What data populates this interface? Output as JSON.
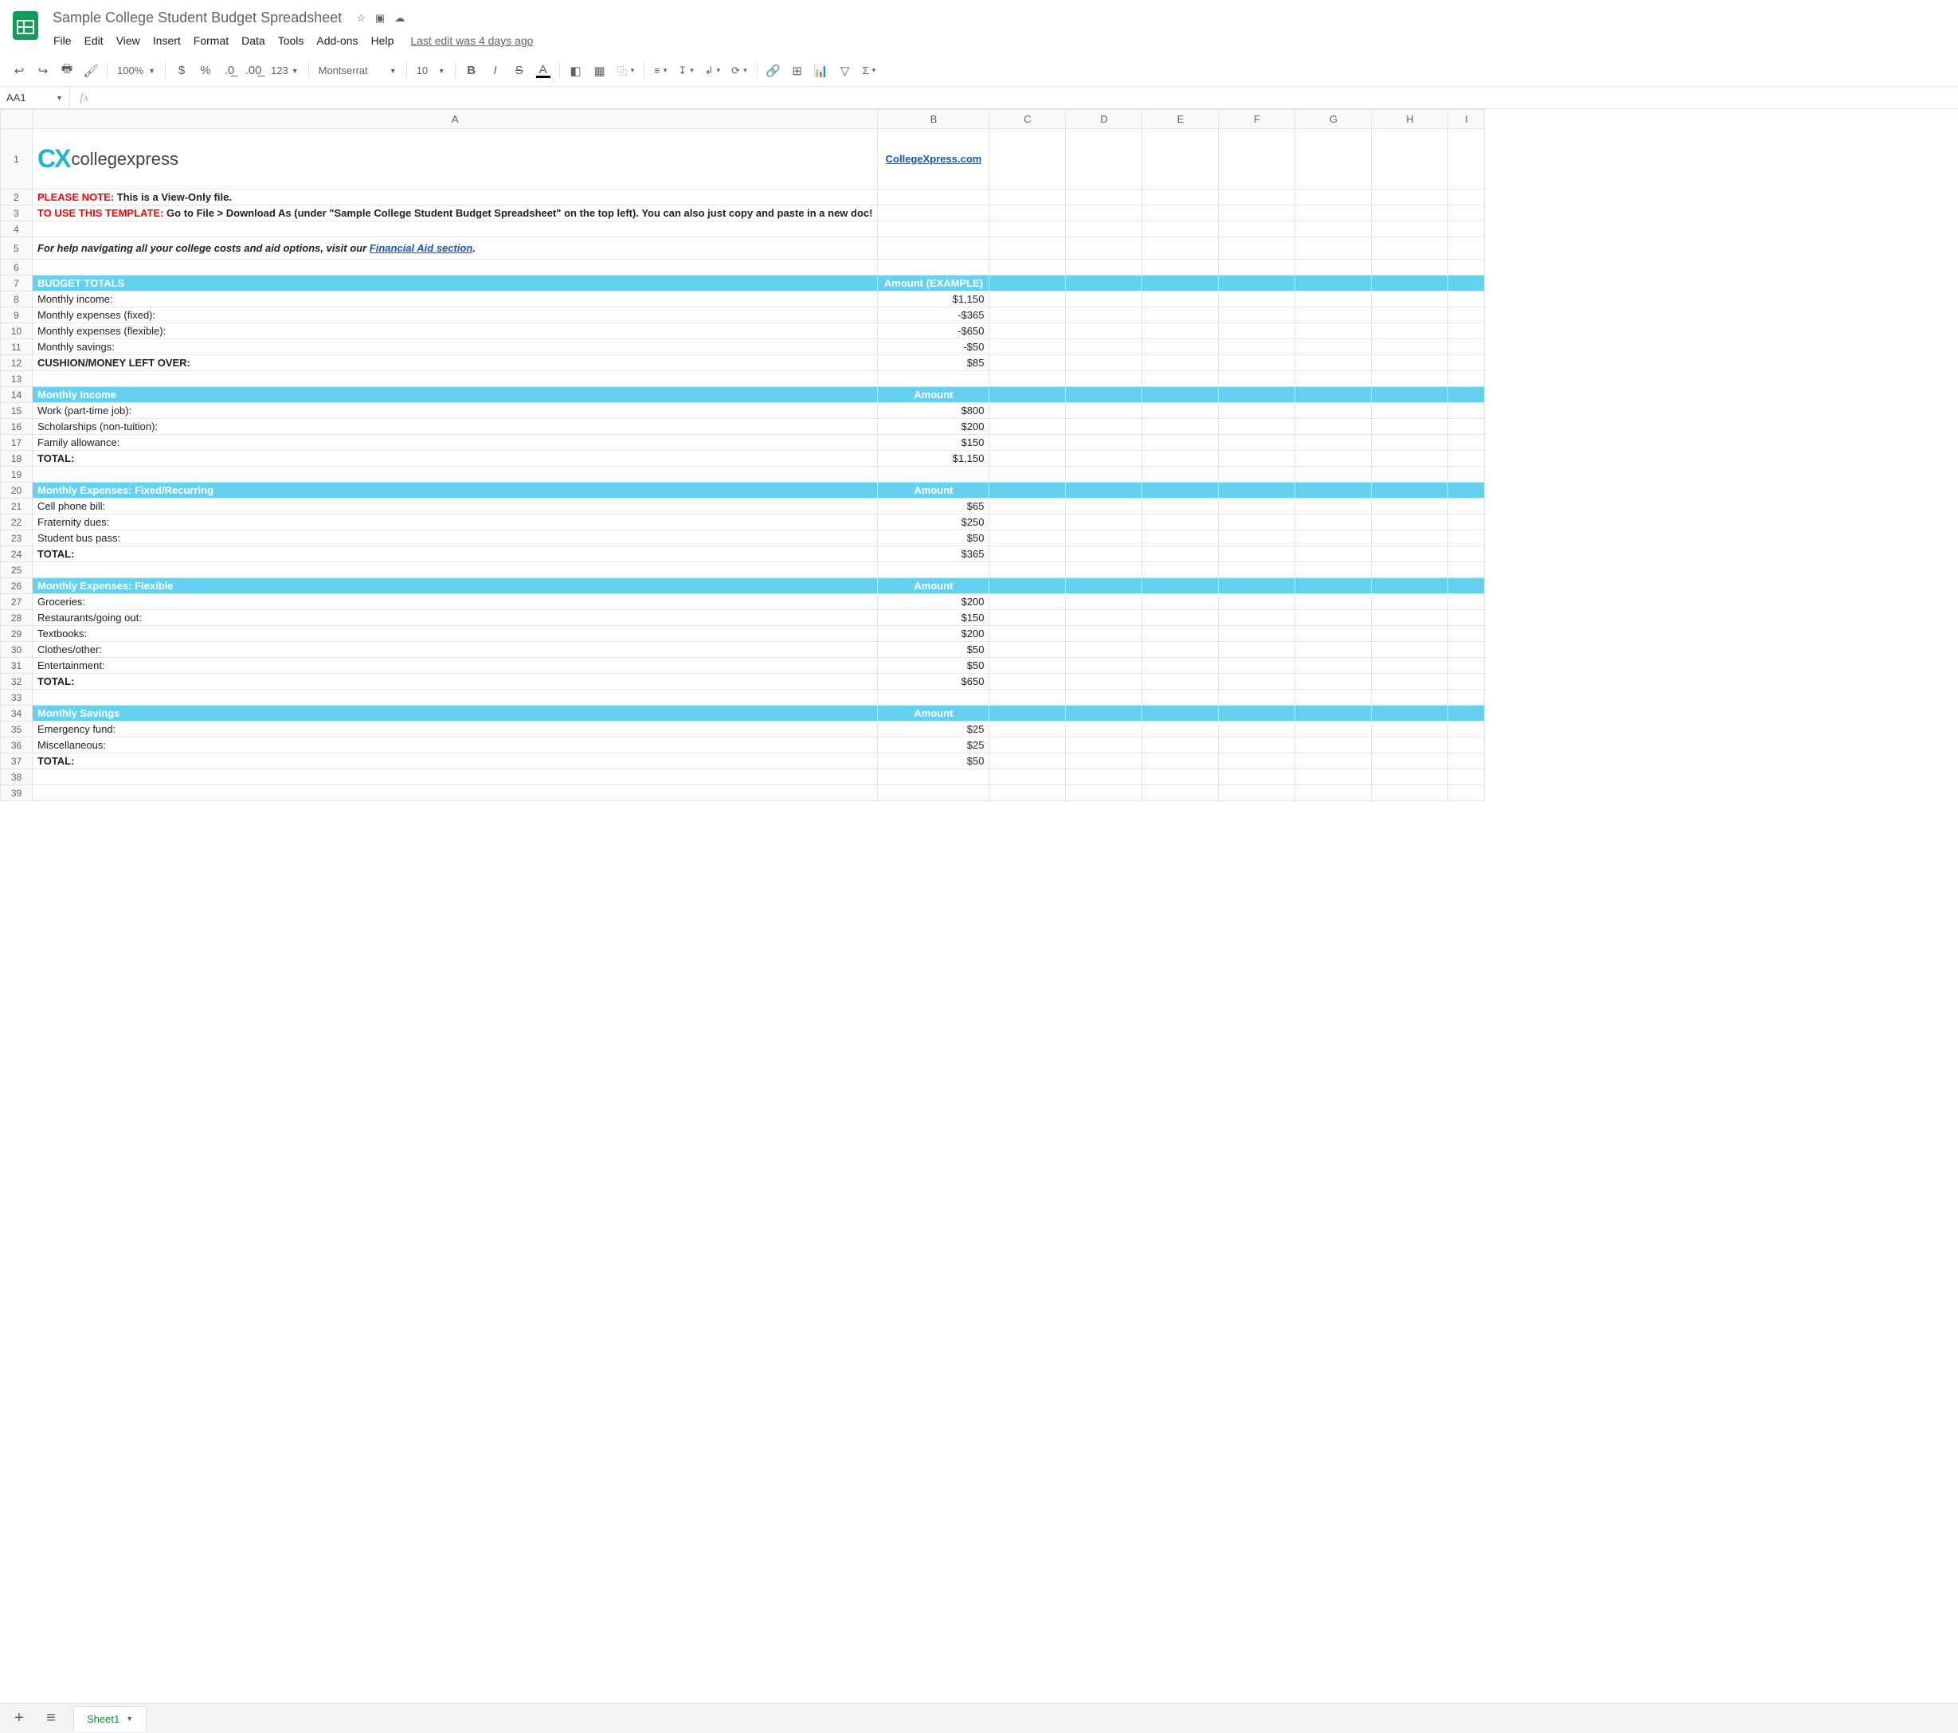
{
  "doc": {
    "title": "Sample College Student Budget Spreadsheet"
  },
  "menus": [
    "File",
    "Edit",
    "View",
    "Insert",
    "Format",
    "Data",
    "Tools",
    "Add-ons",
    "Help"
  ],
  "last_edit": "Last edit was 4 days ago",
  "toolbar": {
    "zoom": "100%",
    "font": "Montserrat",
    "size": "10"
  },
  "namebox": "AA1",
  "columns": [
    "A",
    "B",
    "C",
    "D",
    "E",
    "F",
    "G",
    "H",
    "I"
  ],
  "row_labels": [
    "1",
    "2",
    "3",
    "4",
    "5",
    "6",
    "7",
    "8",
    "9",
    "10",
    "11",
    "12",
    "13",
    "14",
    "15",
    "16",
    "17",
    "18",
    "19",
    "20",
    "21",
    "22",
    "23",
    "24",
    "25",
    "26",
    "27",
    "28",
    "29",
    "30",
    "31",
    "32",
    "33",
    "34",
    "35",
    "36",
    "37",
    "38",
    "39"
  ],
  "r2": {
    "note": "PLEASE NOTE:",
    "rest": " This is a View-Only file."
  },
  "r3": {
    "note": "TO USE THIS TEMPLATE:",
    "rest": " Go to File > Download As (under \"Sample College Student Budget Spreadsheet\" on the top left). You can also just copy and paste in a new doc!"
  },
  "r5": {
    "pre": "For help navigating all your college costs and aid options, visit our ",
    "link": "Financial Aid section",
    "post": "."
  },
  "cxlink": "CollegeXpress.com",
  "cxlogo": {
    "mark": "CX",
    "text": "collegexpress"
  },
  "sections": {
    "totals": {
      "title": "BUDGET TOTALS",
      "amt": "Amount (EXAMPLE)",
      "rows": [
        [
          "Monthly income:",
          "$1,150"
        ],
        [
          "Monthly expenses (fixed):",
          "-$365"
        ],
        [
          "Monthly expenses (flexible):",
          "-$650"
        ],
        [
          "Monthly savings:",
          "-$50"
        ]
      ],
      "total": [
        "CUSHION/MONEY LEFT OVER:",
        "$85"
      ]
    },
    "income": {
      "title": "Monthly Income",
      "amt": "Amount",
      "rows": [
        [
          "Work (part-time job):",
          "$800"
        ],
        [
          "Scholarships (non-tuition):",
          "$200"
        ],
        [
          "Family allowance:",
          "$150"
        ]
      ],
      "total": [
        "TOTAL:",
        "$1,150"
      ]
    },
    "fixed": {
      "title": "Monthly Expenses: Fixed/Recurring",
      "amt": "Amount",
      "rows": [
        [
          "Cell phone bill:",
          "$65"
        ],
        [
          "Fraternity dues:",
          "$250"
        ],
        [
          "Student bus pass:",
          "$50"
        ]
      ],
      "total": [
        "TOTAL:",
        "$365"
      ]
    },
    "flex": {
      "title": "Monthly Expenses: Flexible",
      "amt": "Amount",
      "rows": [
        [
          "Groceries:",
          "$200"
        ],
        [
          "Restaurants/going out:",
          "$150"
        ],
        [
          "Textbooks:",
          "$200"
        ],
        [
          "Clothes/other:",
          "$50"
        ],
        [
          "Entertainment:",
          "$50"
        ]
      ],
      "total": [
        "TOTAL:",
        "$650"
      ]
    },
    "savings": {
      "title": "Monthly Savings",
      "amt": "Amount",
      "rows": [
        [
          "Emergency fund:",
          "$25"
        ],
        [
          "Miscellaneous:",
          "$25"
        ]
      ],
      "total": [
        "TOTAL:",
        "$50"
      ]
    }
  },
  "sheet_tab": "Sheet1"
}
